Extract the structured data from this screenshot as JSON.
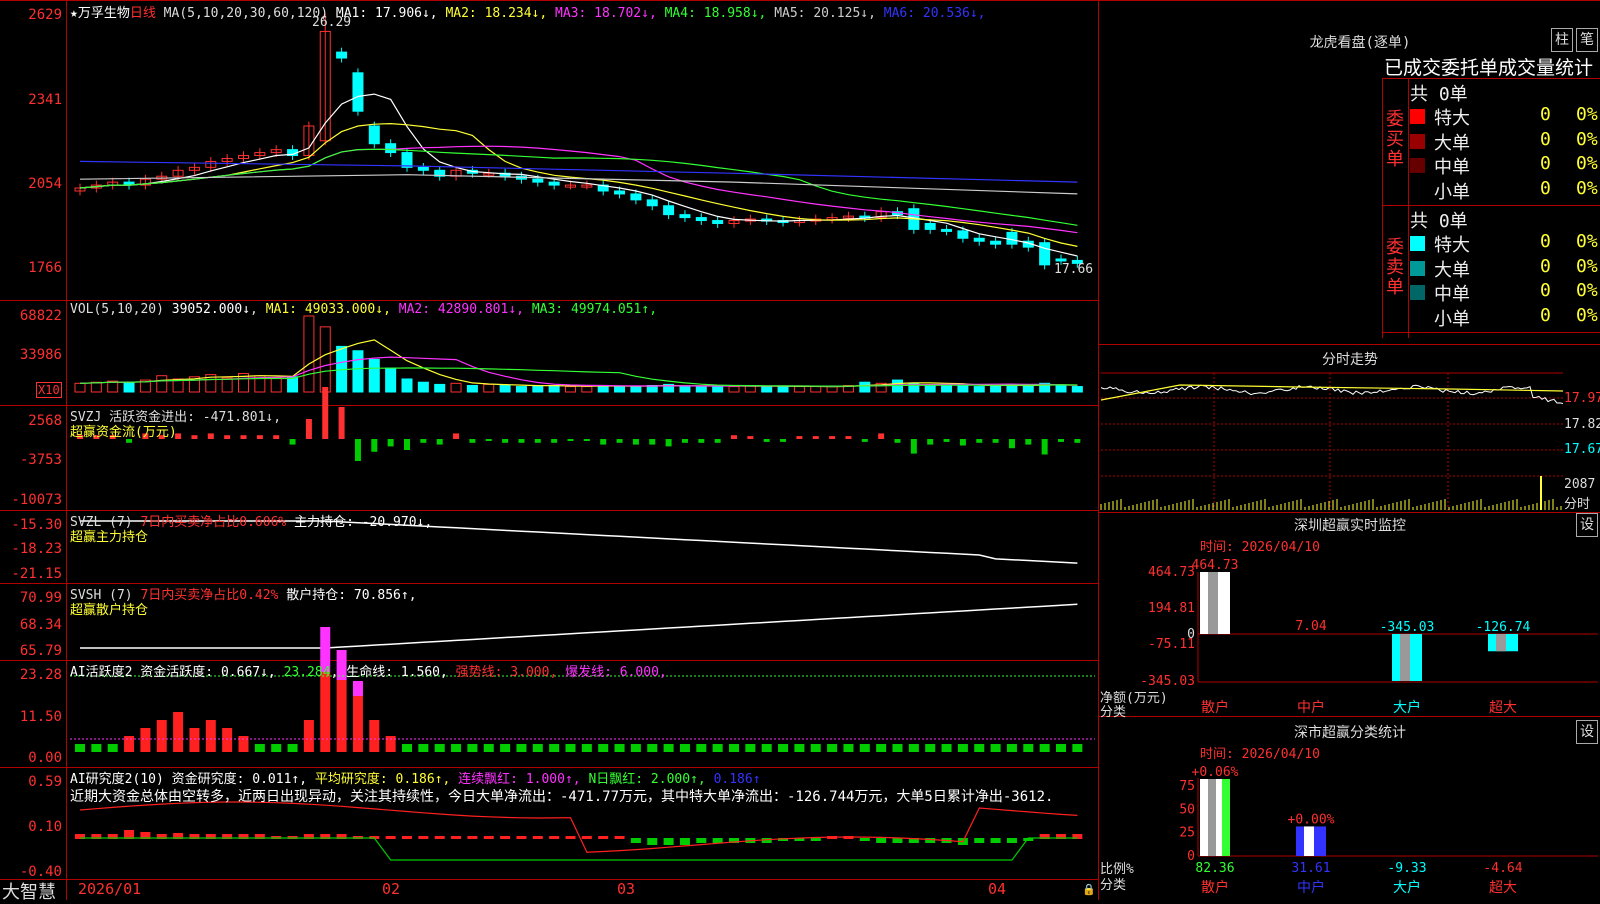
{
  "stock": {
    "name": "★万孚生物",
    "period": "日线"
  },
  "ma_line": {
    "label": "MA(5,10,20,30,60,120)",
    "items": [
      {
        "t": "MA1: 17.906↓",
        "c": "#ffffff"
      },
      {
        "t": "MA2: 18.234↓",
        "c": "#ffff33"
      },
      {
        "t": "MA3: 18.702↓",
        "c": "#ff33ff"
      },
      {
        "t": "MA4: 18.958↓",
        "c": "#33ff33"
      },
      {
        "t": "MA5: 20.125↓",
        "c": "#cccccc"
      },
      {
        "t": "MA6: 20.536↓",
        "c": "#3333ff"
      }
    ]
  },
  "price_axis": [
    "2629",
    "2341",
    "2054",
    "1766"
  ],
  "high_note": "26.29",
  "low_note": "17.66",
  "vol": {
    "label": "VOL(5,10,20)",
    "value": "39052.000↓",
    "items": [
      {
        "t": "MA1: 49033.000↓",
        "c": "#ffff33"
      },
      {
        "t": "MA2: 42890.801↓",
        "c": "#ff33ff"
      },
      {
        "t": "MA3: 49974.051↑",
        "c": "#33ff33"
      }
    ],
    "axis": [
      "68822",
      "33986"
    ],
    "mult": "X10"
  },
  "svzj": {
    "label": "SVZJ  活跃资金进出: -471.801↓,",
    "sub": "超赢资金流(万元)",
    "axis": [
      "2568",
      "-3753",
      "-10073"
    ]
  },
  "svzl": {
    "label": "SVZL (7) ",
    "l2": "7日内买卖净占比0.606%",
    "l3": " 主力持仓: -20.970↓,",
    "sub": "超赢主力持仓",
    "axis": [
      "-15.30",
      "-18.23",
      "-21.15"
    ]
  },
  "svsh": {
    "label": "SVSH (7) ",
    "l2": "7日内买卖净占比0.42%",
    "l3": " 散户持仓: 70.856↑,",
    "sub": "超赢散户持仓",
    "axis": [
      "70.99",
      "68.34",
      "65.79"
    ]
  },
  "ai1": {
    "label": "AI活跃度2 资金活跃度: 0.667↓, ",
    "l2": "23.284",
    "l3": ", 生命线: 1.560,",
    "l4": "强势线: 3.000,",
    "l5": "爆发线: 6.000,",
    "axis": [
      "23.28",
      "11.50",
      "0.00"
    ]
  },
  "ai2": {
    "label": "AI研究度2(10) 资金研究度: 0.011↑, ",
    "l2": "平均研究度: 0.186↑,",
    "l3": "连续飘红: 1.000↑,",
    "l4": "N日飘红: 2.000↑,",
    "l5": "0.186↑",
    "note": "近期大资金总体由空转多，近两日出现异动，关注其持续性，今日大单净流出：-471.77万元，其中特大单净流出：-126.744万元，大单5日累计净出-3612.",
    "axis": [
      "0.59",
      "0.10",
      "-0.40"
    ]
  },
  "xaxis": [
    "2026/01",
    "02",
    "03",
    "04"
  ],
  "brand": "大智慧",
  "right": {
    "dragon_title": "龙虎看盘(逐单)",
    "tab1": "柱",
    "tab2": "笔",
    "stat_header": "已成交委托单成交量统计",
    "buy_label": "委买单",
    "sell_label": "委卖单",
    "buy_total": "共 0单",
    "sell_total": "共 0单",
    "buy_rows": [
      {
        "n": "特大",
        "v": "0",
        "p": "0%",
        "c": "#ff0000"
      },
      {
        "n": "大单",
        "v": "0",
        "p": "0%",
        "c": "#990000"
      },
      {
        "n": "中单",
        "v": "0",
        "p": "0%",
        "c": "#660000"
      },
      {
        "n": "小单",
        "v": "0",
        "p": "0%",
        "c": "#000000"
      }
    ],
    "sell_rows": [
      {
        "n": "特大",
        "v": "0",
        "p": "0%",
        "c": "#00ffff"
      },
      {
        "n": "大单",
        "v": "0",
        "p": "0%",
        "c": "#009999"
      },
      {
        "n": "中单",
        "v": "0",
        "p": "0%",
        "c": "#006666"
      },
      {
        "n": "小单",
        "v": "0",
        "p": "0%",
        "c": "#000000"
      }
    ],
    "fs_title": "分时走势",
    "fs_axis": [
      "17.97",
      "17.82",
      "17.67"
    ],
    "fs_vol": "2087",
    "fs_vol_unit": "分时",
    "sz_title": "深圳超赢实时监控",
    "set": "设",
    "sz_time": "时间: 2026/04/10",
    "sz_axis": [
      "464.73",
      "194.81",
      "0",
      "-75.11",
      "-345.03"
    ],
    "sz_unit": "净额(万元)",
    "sz_cat": "分类",
    "sc_title": "深市超赢分类统计",
    "sc_time": "时间: 2026/04/10",
    "sc_axis": [
      "75",
      "50",
      "25",
      "0"
    ],
    "sc_unit": "比例%",
    "sc_cat": "分类",
    "sc_top": [
      "+0.06%",
      "+0.00%"
    ]
  },
  "chart_data": [
    {
      "type": "bar",
      "title": "深圳超赢实时监控",
      "ylabel": "净额(万元)",
      "categories": [
        "散户",
        "中户",
        "大户",
        "超大"
      ],
      "values": [
        464.73,
        7.04,
        -345.03,
        -126.74
      ],
      "ylim": [
        -345.03,
        464.73
      ]
    },
    {
      "type": "bar",
      "title": "深市超赢分类统计",
      "ylabel": "比例%",
      "categories": [
        "散户",
        "中户",
        "大户",
        "超大"
      ],
      "values": [
        82.36,
        31.61,
        -9.33,
        -4.64
      ],
      "ylim": [
        0,
        75
      ]
    }
  ]
}
